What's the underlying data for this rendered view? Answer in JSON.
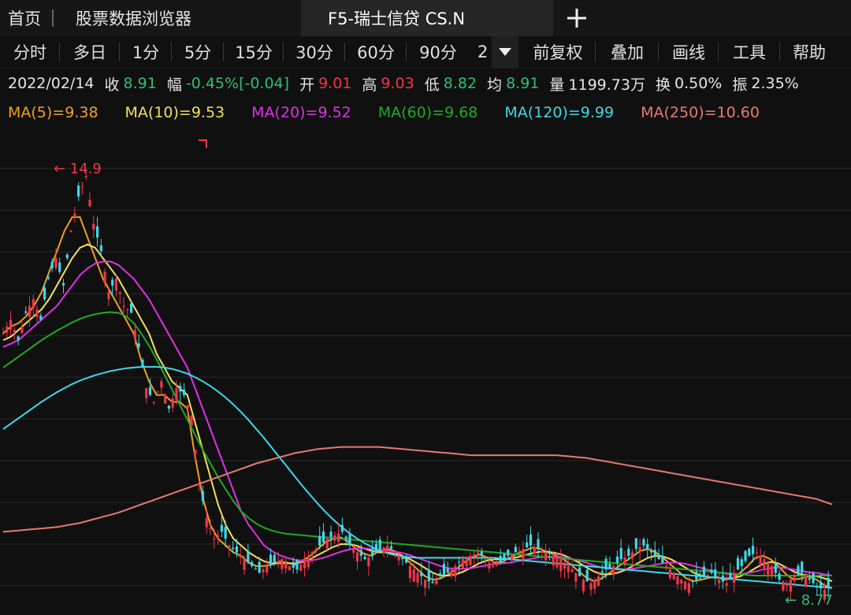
{
  "tabs": {
    "home": "首页",
    "browser": "股票数据浏览器",
    "active": "F5-瑞士信贷 CS.N"
  },
  "periods": [
    "分时",
    "多日",
    "1分",
    "5分",
    "15分",
    "30分",
    "60分",
    "90分",
    "2"
  ],
  "tools": [
    "前复权",
    "叠加",
    "画线",
    "工具",
    "帮助"
  ],
  "quote": {
    "date": "2022/02/14",
    "close_label": "收",
    "close": "8.91",
    "change_label": "幅",
    "change": "-0.45%[-0.04]",
    "open_label": "开",
    "open": "9.01",
    "high_label": "高",
    "high": "9.03",
    "low_label": "低",
    "low": "8.82",
    "avg_label": "均",
    "avg": "8.91",
    "vol_label": "量",
    "vol": "1199.73万",
    "turnover_label": "换",
    "turnover": "0.50%",
    "amp_label": "振",
    "amp": "2.35%"
  },
  "ma_legend": [
    {
      "label": "MA(5)=9.38",
      "color": "#f0a020"
    },
    {
      "label": "MA(10)=9.53",
      "color": "#f2e05a"
    },
    {
      "label": "MA(20)=9.52",
      "color": "#e030e8"
    },
    {
      "label": "MA(60)=9.68",
      "color": "#1faa22"
    },
    {
      "label": "MA(120)=9.99",
      "color": "#3fd8e8"
    },
    {
      "label": "MA(250)=10.60",
      "color": "#e87a72"
    }
  ],
  "chart_data": {
    "type": "candlestick",
    "colors": {
      "up": "#f0364a",
      "down": "#3fd8e8",
      "grid": "#2a2a2a",
      "background": "#101010"
    },
    "ylim": [
      8.6,
      15.4
    ],
    "grid": true,
    "max_marker": "14.9",
    "min_marker": "8.77",
    "close_path": [
      12.6,
      12.8,
      12.5,
      12.9,
      13.1,
      12.8,
      13.4,
      13.7,
      13.3,
      14.1,
      14.6,
      14.9,
      14.2,
      13.8,
      13.2,
      13.4,
      13.0,
      12.9,
      12.4,
      11.8,
      11.6,
      11.9,
      11.5,
      11.8,
      11.7,
      11.4,
      10.4,
      9.9,
      9.6,
      9.7,
      9.5,
      9.4,
      9.3,
      9.2,
      9.1,
      9.2,
      9.25,
      9.3,
      9.2,
      9.15,
      9.3,
      9.4,
      9.5,
      9.6,
      9.65,
      9.7,
      9.5,
      9.4,
      9.3,
      9.35,
      9.45,
      9.5,
      9.4,
      9.3,
      9.2,
      9.1,
      9.0,
      8.95,
      9.05,
      9.1,
      9.2,
      9.3,
      9.35,
      9.4,
      9.3,
      9.2,
      9.25,
      9.35,
      9.4,
      9.45,
      9.5,
      9.45,
      9.4,
      9.35,
      9.3,
      9.2,
      9.1,
      9.0,
      8.95,
      9.05,
      9.15,
      9.2,
      9.3,
      9.35,
      9.45,
      9.5,
      9.4,
      9.3,
      9.2,
      9.1,
      9.0,
      8.95,
      9.0,
      9.05,
      9.1,
      9.0,
      8.95,
      9.1,
      9.2,
      9.35,
      9.4,
      9.3,
      9.2,
      9.0,
      8.95,
      9.05,
      9.1,
      9.0,
      8.9,
      8.85,
      8.91
    ],
    "ma_series": [
      {
        "name": "MA(5)",
        "color": "#f0a020",
        "values": [
          12.6,
          12.7,
          12.75,
          12.85,
          13.0,
          13.2,
          13.5,
          13.8,
          14.1,
          14.3,
          14.3,
          14.0,
          13.7,
          13.4,
          13.2,
          13.0,
          12.8,
          12.6,
          12.2,
          11.9,
          11.7,
          11.7,
          11.6,
          11.6,
          11.5,
          10.8,
          10.2,
          9.8,
          9.6,
          9.5,
          9.4,
          9.35,
          9.25,
          9.2,
          9.2,
          9.22,
          9.27,
          9.25,
          9.22,
          9.28,
          9.35,
          9.45,
          9.55,
          9.6,
          9.62,
          9.55,
          9.45,
          9.38,
          9.35,
          9.42,
          9.45,
          9.42,
          9.35,
          9.25,
          9.15,
          9.05,
          9.0,
          9.02,
          9.08,
          9.15,
          9.25,
          9.32,
          9.37,
          9.33,
          9.25,
          9.26,
          9.32,
          9.38,
          9.43,
          9.47,
          9.45,
          9.4,
          9.36,
          9.3,
          9.22,
          9.12,
          9.03,
          8.98,
          9.02,
          9.1,
          9.18,
          9.26,
          9.34,
          9.42,
          9.45,
          9.4,
          9.32,
          9.22,
          9.12,
          9.02,
          8.98,
          9.0,
          9.03,
          9.04,
          9.0,
          9.02,
          9.1,
          9.2,
          9.32,
          9.35,
          9.3,
          9.2,
          9.08,
          9.0,
          9.02,
          9.05,
          9.0,
          8.92,
          8.88
        ]
      },
      {
        "name": "MA(10)",
        "color": "#f2e05a",
        "values": [
          12.5,
          12.55,
          12.65,
          12.75,
          12.85,
          12.95,
          13.1,
          13.3,
          13.5,
          13.7,
          13.85,
          13.9,
          13.85,
          13.7,
          13.55,
          13.4,
          13.2,
          13.0,
          12.8,
          12.6,
          12.3,
          12.1,
          11.9,
          11.8,
          11.7,
          11.3,
          10.9,
          10.5,
          10.1,
          9.8,
          9.6,
          9.5,
          9.4,
          9.33,
          9.27,
          9.24,
          9.24,
          9.24,
          9.24,
          9.26,
          9.3,
          9.36,
          9.42,
          9.48,
          9.52,
          9.52,
          9.5,
          9.46,
          9.42,
          9.4,
          9.4,
          9.38,
          9.35,
          9.3,
          9.24,
          9.17,
          9.1,
          9.06,
          9.06,
          9.08,
          9.12,
          9.18,
          9.24,
          9.28,
          9.3,
          9.3,
          9.31,
          9.33,
          9.36,
          9.39,
          9.41,
          9.41,
          9.39,
          9.36,
          9.31,
          9.25,
          9.18,
          9.12,
          9.08,
          9.08,
          9.1,
          9.14,
          9.2,
          9.26,
          9.32,
          9.35,
          9.34,
          9.3,
          9.24,
          9.17,
          9.1,
          9.06,
          9.04,
          9.03,
          9.02,
          9.02,
          9.05,
          9.1,
          9.17,
          9.23,
          9.26,
          9.24,
          9.18,
          9.12,
          9.08,
          9.06,
          9.05,
          9.02,
          8.98
        ]
      },
      {
        "name": "MA(20)",
        "color": "#e030e8",
        "values": [
          12.4,
          12.45,
          12.5,
          12.6,
          12.7,
          12.8,
          12.9,
          13.0,
          13.15,
          13.3,
          13.45,
          13.55,
          13.62,
          13.65,
          13.65,
          13.6,
          13.5,
          13.4,
          13.25,
          13.1,
          12.9,
          12.7,
          12.5,
          12.3,
          12.1,
          11.8,
          11.5,
          11.2,
          10.9,
          10.6,
          10.3,
          10.0,
          9.8,
          9.65,
          9.5,
          9.42,
          9.36,
          9.32,
          9.29,
          9.28,
          9.28,
          9.3,
          9.33,
          9.37,
          9.41,
          9.44,
          9.46,
          9.46,
          9.45,
          9.44,
          9.43,
          9.41,
          9.39,
          9.36,
          9.32,
          9.28,
          9.24,
          9.2,
          9.17,
          9.16,
          9.16,
          9.17,
          9.19,
          9.21,
          9.23,
          9.24,
          9.25,
          9.27,
          9.29,
          9.31,
          9.33,
          9.34,
          9.34,
          9.33,
          9.31,
          9.28,
          9.25,
          9.21,
          9.18,
          9.16,
          9.15,
          9.15,
          9.16,
          9.18,
          9.2,
          9.22,
          9.24,
          9.25,
          9.25,
          9.23,
          9.2,
          9.17,
          9.14,
          9.11,
          9.09,
          9.08,
          9.08,
          9.1,
          9.12,
          9.15,
          9.17,
          9.18,
          9.17,
          9.15,
          9.13,
          9.11,
          9.1,
          9.08,
          9.06
        ]
      },
      {
        "name": "MA(60)",
        "color": "#1faa22",
        "values": [
          12.1,
          12.18,
          12.26,
          12.34,
          12.42,
          12.5,
          12.57,
          12.64,
          12.7,
          12.76,
          12.81,
          12.85,
          12.88,
          12.9,
          12.91,
          12.9,
          12.85,
          12.75,
          12.6,
          12.42,
          12.22,
          12.0,
          11.78,
          11.56,
          11.34,
          11.12,
          10.9,
          10.7,
          10.5,
          10.32,
          10.15,
          10.0,
          9.9,
          9.82,
          9.76,
          9.72,
          9.69,
          9.67,
          9.66,
          9.65,
          9.64,
          9.63,
          9.62,
          9.61,
          9.6,
          9.59,
          9.58,
          9.57,
          9.56,
          9.55,
          9.54,
          9.53,
          9.52,
          9.51,
          9.5,
          9.49,
          9.48,
          9.47,
          9.46,
          9.45,
          9.44,
          9.43,
          9.42,
          9.41,
          9.4,
          9.39,
          9.38,
          9.37,
          9.36,
          9.35,
          9.34,
          9.33,
          9.32,
          9.31,
          9.3,
          9.29,
          9.28,
          9.27,
          9.26,
          9.25,
          9.24,
          9.23,
          9.22,
          9.21,
          9.2,
          9.19,
          9.18,
          9.17,
          9.16,
          9.15,
          9.14,
          9.13,
          9.12,
          9.11,
          9.1,
          9.09,
          9.08,
          9.07,
          9.06,
          9.06,
          9.06,
          9.06,
          9.06,
          9.06,
          9.06,
          9.06,
          9.06,
          9.06,
          9.06
        ]
      },
      {
        "name": "MA(120)",
        "color": "#3fd8e8",
        "values": [
          11.2,
          11.28,
          11.36,
          11.44,
          11.52,
          11.6,
          11.67,
          11.74,
          11.8,
          11.86,
          11.91,
          11.95,
          11.99,
          12.02,
          12.05,
          12.07,
          12.09,
          12.1,
          12.11,
          12.11,
          12.11,
          12.1,
          12.08,
          12.05,
          12.01,
          11.96,
          11.9,
          11.83,
          11.75,
          11.66,
          11.56,
          11.45,
          11.33,
          11.2,
          11.07,
          10.93,
          10.79,
          10.65,
          10.51,
          10.37,
          10.24,
          10.11,
          9.99,
          9.88,
          9.78,
          9.69,
          9.61,
          9.54,
          9.48,
          9.43,
          9.39,
          9.36,
          9.34,
          9.33,
          9.32,
          9.32,
          9.32,
          9.32,
          9.32,
          9.32,
          9.32,
          9.32,
          9.32,
          9.32,
          9.32,
          9.31,
          9.3,
          9.29,
          9.28,
          9.27,
          9.26,
          9.25,
          9.24,
          9.23,
          9.22,
          9.21,
          9.2,
          9.19,
          9.18,
          9.17,
          9.16,
          9.15,
          9.14,
          9.13,
          9.12,
          9.11,
          9.1,
          9.09,
          9.08,
          9.07,
          9.06,
          9.05,
          9.04,
          9.03,
          9.02,
          9.01,
          9.0,
          8.99,
          8.98,
          8.97,
          8.96,
          8.95,
          8.94,
          8.93,
          8.92,
          8.91,
          8.9,
          8.89,
          8.88
        ]
      },
      {
        "name": "MA(250)",
        "color": "#e87a72",
        "values": [
          9.7,
          9.71,
          9.72,
          9.73,
          9.74,
          9.75,
          9.76,
          9.77,
          9.79,
          9.81,
          9.83,
          9.86,
          9.89,
          9.92,
          9.95,
          9.98,
          10.02,
          10.06,
          10.1,
          10.14,
          10.18,
          10.22,
          10.26,
          10.3,
          10.34,
          10.38,
          10.42,
          10.46,
          10.5,
          10.54,
          10.58,
          10.62,
          10.66,
          10.7,
          10.73,
          10.76,
          10.79,
          10.82,
          10.85,
          10.87,
          10.89,
          10.91,
          10.92,
          10.93,
          10.94,
          10.94,
          10.94,
          10.94,
          10.94,
          10.94,
          10.93,
          10.92,
          10.91,
          10.9,
          10.89,
          10.88,
          10.87,
          10.86,
          10.85,
          10.84,
          10.83,
          10.82,
          10.82,
          10.82,
          10.82,
          10.82,
          10.82,
          10.82,
          10.82,
          10.82,
          10.82,
          10.82,
          10.82,
          10.81,
          10.8,
          10.79,
          10.78,
          10.76,
          10.74,
          10.72,
          10.7,
          10.68,
          10.66,
          10.64,
          10.62,
          10.6,
          10.58,
          10.56,
          10.54,
          10.52,
          10.5,
          10.48,
          10.46,
          10.44,
          10.42,
          10.4,
          10.38,
          10.36,
          10.34,
          10.32,
          10.3,
          10.28,
          10.26,
          10.24,
          10.22,
          10.2,
          10.18,
          10.14,
          10.1
        ]
      }
    ]
  }
}
